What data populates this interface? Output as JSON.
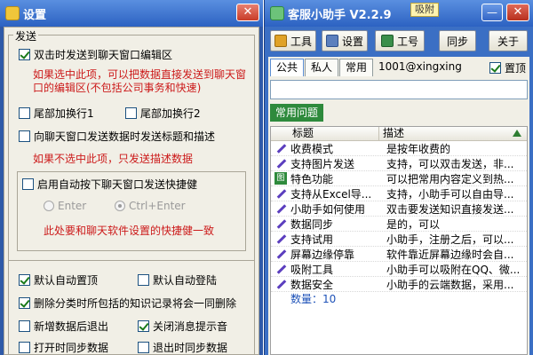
{
  "settings": {
    "title": "设置",
    "send_group": "发送",
    "opt_dblclick": "双击时发送到聊天窗口编辑区",
    "note_dblclick": "如果选中此项，可以把数据直接发送到聊天窗口的编辑区(不包括公司事务和快速)",
    "opt_tail1": "尾部加换行1",
    "opt_tail2": "尾部加换行2",
    "opt_send_title": "向聊天窗口发送数据时发送标题和描述",
    "note_send_title": "如果不选中此项，只发送描述数据",
    "opt_auto_shortcut": "启用自动按下聊天窗口发送快捷健",
    "radio_enter": "Enter",
    "radio_ctrl_enter": "Ctrl+Enter",
    "note_shortcut": "此处要和聊天软件设置的快捷健一致",
    "opt_default_top": "默认自动置顶",
    "opt_default_login": "默认自动登陆",
    "opt_delete_sync": "删除分类时所包括的知识记录将会一同删除",
    "opt_exit_after_add": "新增数据后退出",
    "opt_close_sound": "关闭消息提示音",
    "opt_sync_open": "打开时同步数据",
    "opt_sync_exit": "退出时同步数据",
    "checks": {
      "dblclick": true,
      "tail1": false,
      "tail2": false,
      "send_title": false,
      "auto_shortcut": false,
      "default_top": true,
      "default_login": false,
      "delete_sync": true,
      "exit_after_add": false,
      "close_sound": true,
      "sync_open": false,
      "sync_exit": false
    }
  },
  "helper": {
    "title": "客服小助手 V2.2.9",
    "tag": "吸附",
    "btn_tools": "工具",
    "btn_settings": "设置",
    "btn_badge": "工号",
    "btn_sync": "同步",
    "btn_about": "关于",
    "tabs": [
      "公共",
      "私人",
      "常用"
    ],
    "account": "1001@xingxing",
    "pin_label": "置顶",
    "category": "常用问题",
    "col_title": "标题",
    "col_desc": "描述",
    "rows": [
      {
        "icon": "pen",
        "title": "收费模式",
        "desc": "是按年收费的"
      },
      {
        "icon": "pen",
        "title": "支持图片发送",
        "desc": "支持，可以双击发送，非..."
      },
      {
        "icon": "green",
        "title": "特色功能",
        "desc": "可以把常用内容定义到热..."
      },
      {
        "icon": "pen",
        "title": "支持从Excel导...",
        "desc": "支持，小助手可以自由导..."
      },
      {
        "icon": "pen",
        "title": "小助手如何使用",
        "desc": "双击要发送知识直接发送..."
      },
      {
        "icon": "pen",
        "title": "数据同步",
        "desc": "是的，可以"
      },
      {
        "icon": "pen",
        "title": "支持试用",
        "desc": "小助手，注册之后，可以..."
      },
      {
        "icon": "pen",
        "title": "屏幕边缘停靠",
        "desc": "软件靠近屏幕边缘时会自..."
      },
      {
        "icon": "pen",
        "title": "吸附工具",
        "desc": "小助手可以吸附在QQ、微..."
      },
      {
        "icon": "pen",
        "title": "数据安全",
        "desc": "小助手的云端数据，采用..."
      }
    ],
    "count_label": "数量：",
    "count_value": "10",
    "close": "关"
  }
}
